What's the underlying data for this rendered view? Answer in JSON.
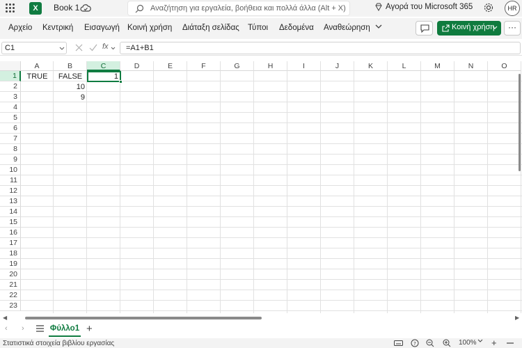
{
  "titlebar": {
    "app_icon": "excel-logo",
    "book_title": "Book 1",
    "search_placeholder": "Αναζήτηση για εργαλεία, βοήθεια και πολλά άλλα (Alt + X)",
    "m365_label": "Αγορά του Microsoft 365",
    "avatar_initials": "HR"
  },
  "ribbon": {
    "tabs": [
      "Αρχείο",
      "Κεντρική",
      "Εισαγωγή",
      "Κοινή χρήση",
      "Διάταξη σελίδας",
      "Τύποι",
      "Δεδομένα",
      "Αναθεώρηση"
    ],
    "share_label": "Κοινή χρήση",
    "more_label": "···"
  },
  "formula_bar": {
    "name_box": "C1",
    "fx_label": "fx",
    "formula": "=A1+B1"
  },
  "grid": {
    "columns": [
      "A",
      "B",
      "C",
      "D",
      "E",
      "F",
      "G",
      "H",
      "I",
      "J",
      "K",
      "L",
      "M",
      "N",
      "O"
    ],
    "rows": [
      "1",
      "2",
      "3",
      "4",
      "5",
      "6",
      "7",
      "8",
      "9",
      "10",
      "11",
      "12",
      "13",
      "14",
      "15",
      "16",
      "17",
      "18",
      "19",
      "20",
      "21",
      "22",
      "23"
    ],
    "selected_column": "C",
    "selected_row": "1",
    "cells": {
      "A1": "TRUE",
      "B1": "FALSE",
      "C1": "1",
      "B2": "10",
      "B3": "9"
    }
  },
  "sheets": {
    "tabs": [
      "Φύλλο1"
    ],
    "active": "Φύλλο1"
  },
  "statusbar": {
    "stats_label": "Στατιστικά στοιχεία βιβλίου εργασίας",
    "zoom": "100%"
  },
  "colors": {
    "accent": "#107c41",
    "share_bg": "#0f7b3e"
  }
}
